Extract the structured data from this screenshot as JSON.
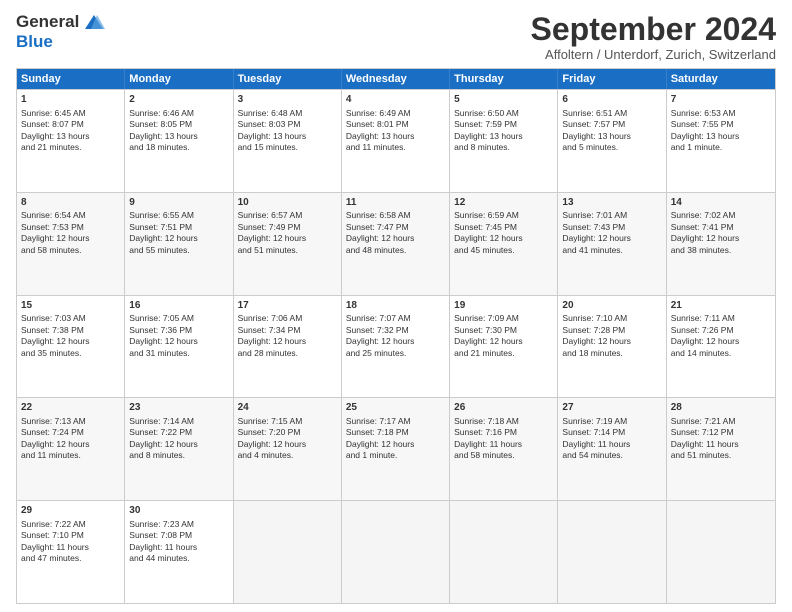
{
  "logo": {
    "general": "General",
    "blue": "Blue"
  },
  "title": "September 2024",
  "subtitle": "Affoltern / Unterdorf, Zurich, Switzerland",
  "headers": [
    "Sunday",
    "Monday",
    "Tuesday",
    "Wednesday",
    "Thursday",
    "Friday",
    "Saturday"
  ],
  "rows": [
    [
      {
        "day": "1",
        "lines": [
          "Sunrise: 6:45 AM",
          "Sunset: 8:07 PM",
          "Daylight: 13 hours",
          "and 21 minutes."
        ]
      },
      {
        "day": "2",
        "lines": [
          "Sunrise: 6:46 AM",
          "Sunset: 8:05 PM",
          "Daylight: 13 hours",
          "and 18 minutes."
        ]
      },
      {
        "day": "3",
        "lines": [
          "Sunrise: 6:48 AM",
          "Sunset: 8:03 PM",
          "Daylight: 13 hours",
          "and 15 minutes."
        ]
      },
      {
        "day": "4",
        "lines": [
          "Sunrise: 6:49 AM",
          "Sunset: 8:01 PM",
          "Daylight: 13 hours",
          "and 11 minutes."
        ]
      },
      {
        "day": "5",
        "lines": [
          "Sunrise: 6:50 AM",
          "Sunset: 7:59 PM",
          "Daylight: 13 hours",
          "and 8 minutes."
        ]
      },
      {
        "day": "6",
        "lines": [
          "Sunrise: 6:51 AM",
          "Sunset: 7:57 PM",
          "Daylight: 13 hours",
          "and 5 minutes."
        ]
      },
      {
        "day": "7",
        "lines": [
          "Sunrise: 6:53 AM",
          "Sunset: 7:55 PM",
          "Daylight: 13 hours",
          "and 1 minute."
        ]
      }
    ],
    [
      {
        "day": "8",
        "lines": [
          "Sunrise: 6:54 AM",
          "Sunset: 7:53 PM",
          "Daylight: 12 hours",
          "and 58 minutes."
        ]
      },
      {
        "day": "9",
        "lines": [
          "Sunrise: 6:55 AM",
          "Sunset: 7:51 PM",
          "Daylight: 12 hours",
          "and 55 minutes."
        ]
      },
      {
        "day": "10",
        "lines": [
          "Sunrise: 6:57 AM",
          "Sunset: 7:49 PM",
          "Daylight: 12 hours",
          "and 51 minutes."
        ]
      },
      {
        "day": "11",
        "lines": [
          "Sunrise: 6:58 AM",
          "Sunset: 7:47 PM",
          "Daylight: 12 hours",
          "and 48 minutes."
        ]
      },
      {
        "day": "12",
        "lines": [
          "Sunrise: 6:59 AM",
          "Sunset: 7:45 PM",
          "Daylight: 12 hours",
          "and 45 minutes."
        ]
      },
      {
        "day": "13",
        "lines": [
          "Sunrise: 7:01 AM",
          "Sunset: 7:43 PM",
          "Daylight: 12 hours",
          "and 41 minutes."
        ]
      },
      {
        "day": "14",
        "lines": [
          "Sunrise: 7:02 AM",
          "Sunset: 7:41 PM",
          "Daylight: 12 hours",
          "and 38 minutes."
        ]
      }
    ],
    [
      {
        "day": "15",
        "lines": [
          "Sunrise: 7:03 AM",
          "Sunset: 7:38 PM",
          "Daylight: 12 hours",
          "and 35 minutes."
        ]
      },
      {
        "day": "16",
        "lines": [
          "Sunrise: 7:05 AM",
          "Sunset: 7:36 PM",
          "Daylight: 12 hours",
          "and 31 minutes."
        ]
      },
      {
        "day": "17",
        "lines": [
          "Sunrise: 7:06 AM",
          "Sunset: 7:34 PM",
          "Daylight: 12 hours",
          "and 28 minutes."
        ]
      },
      {
        "day": "18",
        "lines": [
          "Sunrise: 7:07 AM",
          "Sunset: 7:32 PM",
          "Daylight: 12 hours",
          "and 25 minutes."
        ]
      },
      {
        "day": "19",
        "lines": [
          "Sunrise: 7:09 AM",
          "Sunset: 7:30 PM",
          "Daylight: 12 hours",
          "and 21 minutes."
        ]
      },
      {
        "day": "20",
        "lines": [
          "Sunrise: 7:10 AM",
          "Sunset: 7:28 PM",
          "Daylight: 12 hours",
          "and 18 minutes."
        ]
      },
      {
        "day": "21",
        "lines": [
          "Sunrise: 7:11 AM",
          "Sunset: 7:26 PM",
          "Daylight: 12 hours",
          "and 14 minutes."
        ]
      }
    ],
    [
      {
        "day": "22",
        "lines": [
          "Sunrise: 7:13 AM",
          "Sunset: 7:24 PM",
          "Daylight: 12 hours",
          "and 11 minutes."
        ]
      },
      {
        "day": "23",
        "lines": [
          "Sunrise: 7:14 AM",
          "Sunset: 7:22 PM",
          "Daylight: 12 hours",
          "and 8 minutes."
        ]
      },
      {
        "day": "24",
        "lines": [
          "Sunrise: 7:15 AM",
          "Sunset: 7:20 PM",
          "Daylight: 12 hours",
          "and 4 minutes."
        ]
      },
      {
        "day": "25",
        "lines": [
          "Sunrise: 7:17 AM",
          "Sunset: 7:18 PM",
          "Daylight: 12 hours",
          "and 1 minute."
        ]
      },
      {
        "day": "26",
        "lines": [
          "Sunrise: 7:18 AM",
          "Sunset: 7:16 PM",
          "Daylight: 11 hours",
          "and 58 minutes."
        ]
      },
      {
        "day": "27",
        "lines": [
          "Sunrise: 7:19 AM",
          "Sunset: 7:14 PM",
          "Daylight: 11 hours",
          "and 54 minutes."
        ]
      },
      {
        "day": "28",
        "lines": [
          "Sunrise: 7:21 AM",
          "Sunset: 7:12 PM",
          "Daylight: 11 hours",
          "and 51 minutes."
        ]
      }
    ],
    [
      {
        "day": "29",
        "lines": [
          "Sunrise: 7:22 AM",
          "Sunset: 7:10 PM",
          "Daylight: 11 hours",
          "and 47 minutes."
        ]
      },
      {
        "day": "30",
        "lines": [
          "Sunrise: 7:23 AM",
          "Sunset: 7:08 PM",
          "Daylight: 11 hours",
          "and 44 minutes."
        ]
      },
      {
        "day": "",
        "lines": [],
        "empty": true
      },
      {
        "day": "",
        "lines": [],
        "empty": true
      },
      {
        "day": "",
        "lines": [],
        "empty": true
      },
      {
        "day": "",
        "lines": [],
        "empty": true
      },
      {
        "day": "",
        "lines": [],
        "empty": true
      }
    ]
  ]
}
